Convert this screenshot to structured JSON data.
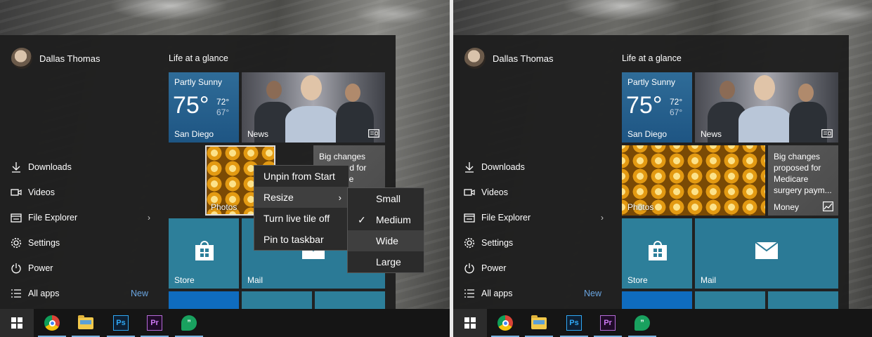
{
  "user": {
    "name": "Dallas Thomas"
  },
  "group_title": "Life at a glance",
  "nav": [
    {
      "label": "Downloads",
      "icon": "download-icon"
    },
    {
      "label": "Videos",
      "icon": "video-icon"
    },
    {
      "label": "File Explorer",
      "icon": "file-explorer-icon"
    },
    {
      "label": "Settings",
      "icon": "gear-icon"
    },
    {
      "label": "Power",
      "icon": "power-icon"
    },
    {
      "label": "All apps",
      "icon": "list-icon",
      "badge": "New"
    }
  ],
  "tiles": {
    "weather": {
      "condition": "Partly Sunny",
      "temp": "75°",
      "high": "72°",
      "low": "67°",
      "city": "San Diego"
    },
    "news": {
      "label": "News"
    },
    "photos": {
      "label": "Photos"
    },
    "money": {
      "headline_left": "Big changes proposed for Medicare surgery paym...",
      "headline_right": "Big changes proposed for Medicare surgery paym...",
      "label": "Money"
    },
    "store": {
      "label": "Store"
    },
    "mail": {
      "label": "Mail"
    }
  },
  "context_menu": {
    "items": [
      "Unpin from Start",
      "Resize",
      "Turn live tile off",
      "Pin to taskbar"
    ],
    "submenu": [
      "Small",
      "Medium",
      "Wide",
      "Large"
    ],
    "checked": "Medium",
    "hover": "Wide"
  },
  "taskbar": {
    "apps": [
      "start-icon",
      "chrome-icon",
      "file-explorer-icon",
      "photoshop-icon",
      "premiere-icon",
      "hangouts-icon"
    ],
    "ps_text": "Ps",
    "pr_text": "Pr",
    "hangouts_text": "”"
  },
  "colors": {
    "accent": "#2d7f9a",
    "weather": "#1e5583",
    "taskbar": "#151515"
  }
}
